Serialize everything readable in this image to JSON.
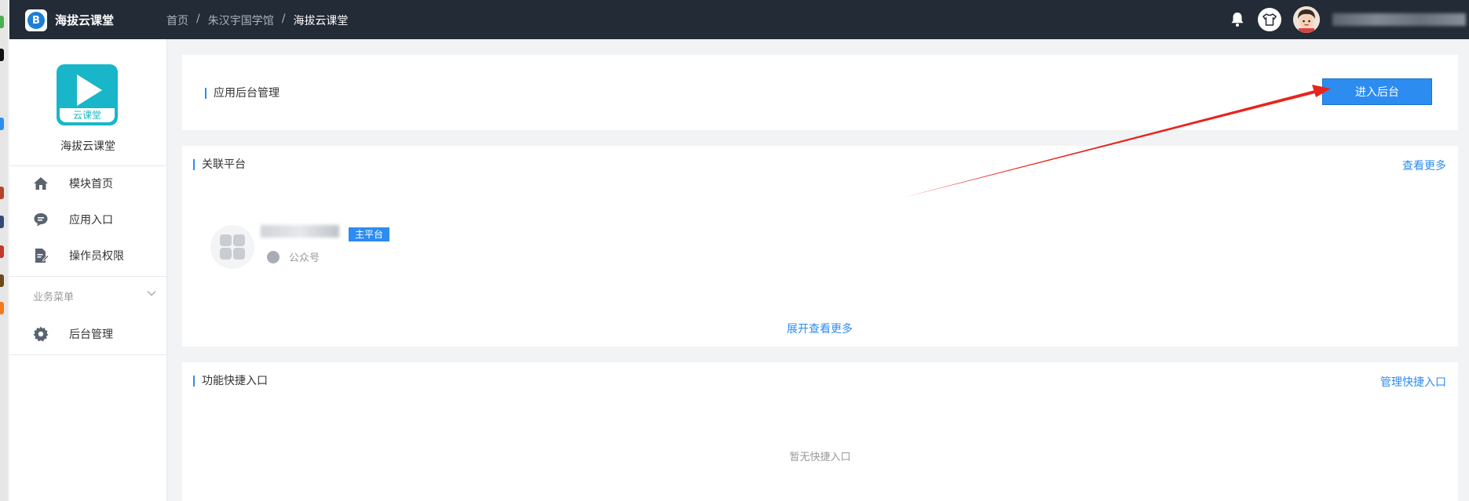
{
  "topbar": {
    "app_name": "海拔云课堂",
    "breadcrumbs": [
      "首页",
      "朱汉宇国学馆",
      "海拔云课堂"
    ],
    "separator": "/",
    "bg_color": "#222b36"
  },
  "sidebar": {
    "logo_label": "云课堂",
    "title": "海拔云课堂",
    "items": [
      {
        "label": "模块首页",
        "icon": "home-icon"
      },
      {
        "label": "应用入口",
        "icon": "chat-icon"
      },
      {
        "label": "操作员权限",
        "icon": "document-edit-icon"
      }
    ],
    "section_title": "业务菜单",
    "section_items": [
      {
        "label": "后台管理",
        "icon": "gear-icon"
      }
    ]
  },
  "admin_card": {
    "title": "应用后台管理",
    "enter_button": "进入后台"
  },
  "platform_card": {
    "title": "关联平台",
    "more_link": "查看更多",
    "platform": {
      "badge": "主平台",
      "type": "公众号"
    },
    "expand_link": "展开查看更多"
  },
  "shortcut_card": {
    "title": "功能快捷入口",
    "manage_link": "管理快捷入口",
    "empty_text": "暂无快捷入口"
  },
  "colors": {
    "accent": "#2d8cf0",
    "annotation_arrow": "#e8241c"
  }
}
